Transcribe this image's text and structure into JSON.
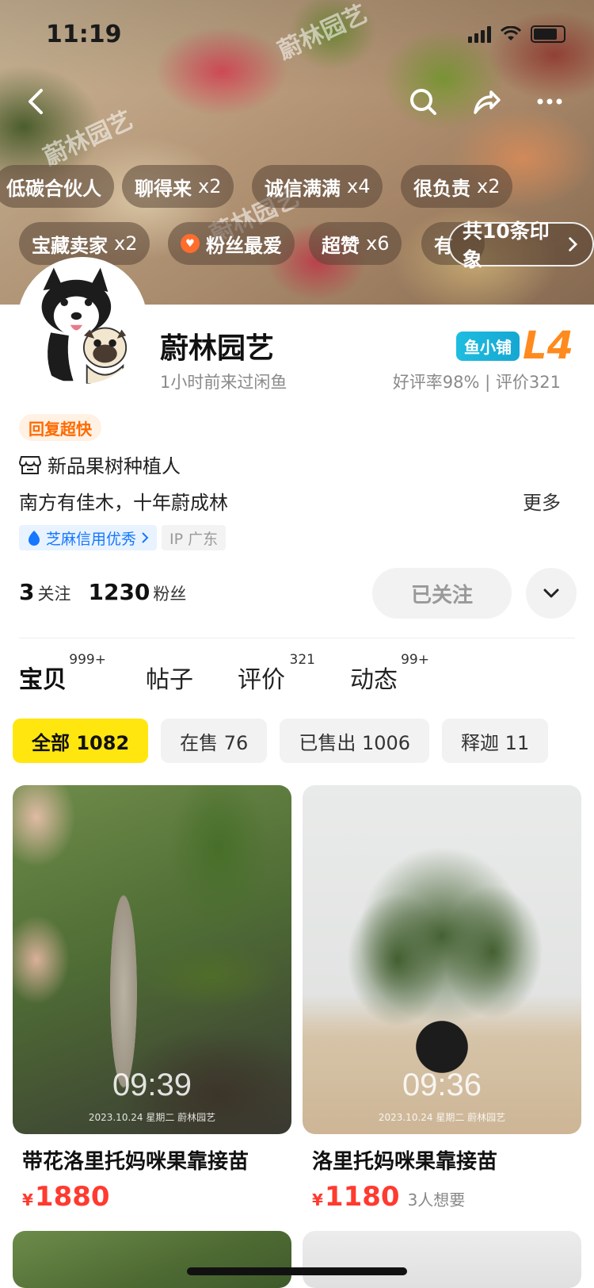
{
  "status_bar": {
    "time": "11:19"
  },
  "banner": {
    "watermarks": [
      "蔚林园艺",
      "蔚林园艺",
      "蔚林园艺"
    ],
    "tags_row1": [
      {
        "label": "低碳合伙人",
        "count": ""
      },
      {
        "label": "聊得来",
        "count": "x2"
      },
      {
        "label": "诚信满满",
        "count": "x4"
      },
      {
        "label": "很负责",
        "count": "x2"
      }
    ],
    "tags_row2": [
      {
        "label": "宝藏卖家",
        "count": "x2"
      },
      {
        "label": "粉丝最爱",
        "count": ""
      },
      {
        "label": "超赞",
        "count": "x6"
      },
      {
        "label": "有",
        "count": ""
      }
    ],
    "all_impressions": "共10条印象"
  },
  "profile": {
    "name": "蔚林园艺",
    "last_seen": "1小时前来过闲鱼",
    "level_label": "鱼小铺",
    "level": "L4",
    "rating": "好评率98% | 评价321",
    "reply_badge": "回复超快",
    "intro": "新品果树种植人",
    "motto": "南方有佳木，十年蔚成林",
    "more": "更多",
    "credit": "芝麻信用优秀",
    "ip": "IP 广东",
    "following_count": "3",
    "following_label": "关注",
    "fans_count": "1230",
    "fans_label": "粉丝",
    "follow_state": "已关注"
  },
  "tabs": [
    {
      "label": "宝贝",
      "badge": "999+"
    },
    {
      "label": "帖子",
      "badge": ""
    },
    {
      "label": "评价",
      "badge": "321"
    },
    {
      "label": "动态",
      "badge": "99+"
    }
  ],
  "filters": [
    "全部 1082",
    "在售 76",
    "已售出 1006",
    "释迦 11"
  ],
  "products": [
    {
      "title": "带花洛里托妈咪果靠接苗",
      "currency": "¥",
      "price": "1880",
      "wants": "",
      "image_time": "09:39",
      "image_stamp": "2023.10.24 星期二 蔚林园艺"
    },
    {
      "title": "洛里托妈咪果靠接苗",
      "currency": "¥",
      "price": "1180",
      "wants": "3人想要",
      "image_time": "09:36",
      "image_stamp": "2023.10.24 星期二 蔚林园艺"
    }
  ],
  "colors": {
    "accent_yellow": "#ffe60f",
    "price_red": "#ff3a2f",
    "level_orange": "#ff8a1e",
    "credit_blue": "#1677ff"
  }
}
